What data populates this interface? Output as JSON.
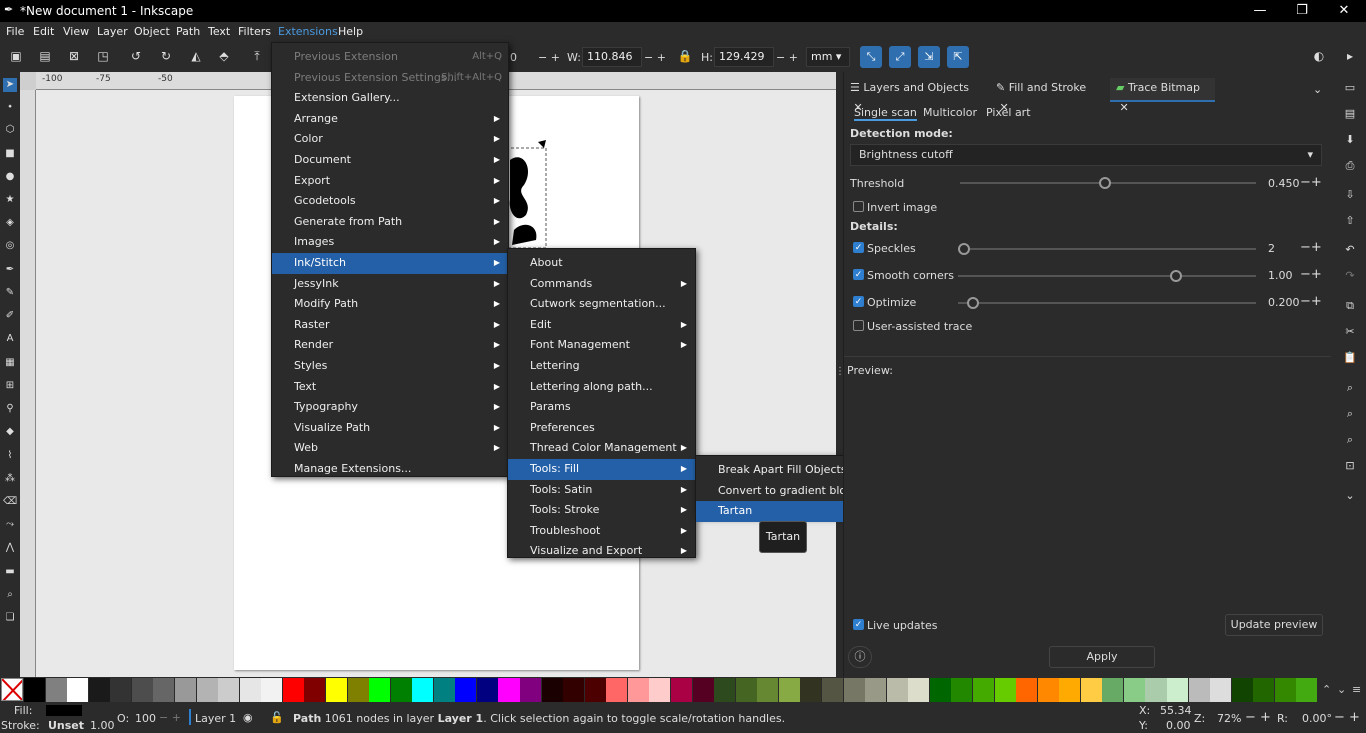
{
  "window": {
    "title": "*New document 1 - Inkscape"
  },
  "menubar": [
    "File",
    "Edit",
    "View",
    "Layer",
    "Object",
    "Path",
    "Text",
    "Filters",
    "Extensions",
    "Help"
  ],
  "toolbar": {
    "x_value_partial": "0",
    "w_label": "W:",
    "w_value": "110.846",
    "h_label": "H:",
    "h_value": "129.429",
    "unit": "mm"
  },
  "ruler": {
    "ticks": [
      "-100",
      "-75",
      "-50"
    ]
  },
  "extensions_menu": [
    {
      "label": "Previous Extension",
      "shortcut": "Alt+Q",
      "disabled": true
    },
    {
      "label": "Previous Extension Settings...",
      "shortcut": "Shift+Alt+Q",
      "disabled": true
    },
    {
      "label": "Extension Gallery..."
    },
    {
      "label": "Arrange",
      "sub": true
    },
    {
      "label": "Color",
      "sub": true
    },
    {
      "label": "Document",
      "sub": true
    },
    {
      "label": "Export",
      "sub": true
    },
    {
      "label": "Gcodetools",
      "sub": true
    },
    {
      "label": "Generate from Path",
      "sub": true
    },
    {
      "label": "Images",
      "sub": true
    },
    {
      "label": "Ink/Stitch",
      "sub": true,
      "hl": true
    },
    {
      "label": "JessyInk",
      "sub": true
    },
    {
      "label": "Modify Path",
      "sub": true
    },
    {
      "label": "Raster",
      "sub": true
    },
    {
      "label": "Render",
      "sub": true
    },
    {
      "label": "Styles",
      "sub": true
    },
    {
      "label": "Text",
      "sub": true
    },
    {
      "label": "Typography",
      "sub": true
    },
    {
      "label": "Visualize Path",
      "sub": true
    },
    {
      "label": "Web",
      "sub": true
    },
    {
      "label": "Manage Extensions..."
    }
  ],
  "inkstitch_menu": [
    {
      "label": "About"
    },
    {
      "label": "Commands",
      "sub": true
    },
    {
      "label": "Cutwork segmentation..."
    },
    {
      "label": "Edit",
      "sub": true
    },
    {
      "label": "Font Management",
      "sub": true
    },
    {
      "label": "Lettering"
    },
    {
      "label": "Lettering along path..."
    },
    {
      "label": "Params"
    },
    {
      "label": "Preferences"
    },
    {
      "label": "Thread Color Management",
      "sub": true
    },
    {
      "label": "Tools: Fill",
      "sub": true,
      "hl": true
    },
    {
      "label": "Tools: Satin",
      "sub": true
    },
    {
      "label": "Tools: Stroke",
      "sub": true
    },
    {
      "label": "Troubleshoot",
      "sub": true
    },
    {
      "label": "Visualize and Export",
      "sub": true
    }
  ],
  "fill_menu": [
    {
      "label": "Break Apart Fill Objects..."
    },
    {
      "label": "Convert to gradient blocks..."
    },
    {
      "label": "Tartan",
      "hl": true
    }
  ],
  "tooltip": "Tartan",
  "dock": {
    "tabs": [
      "Layers and Objects",
      "Fill and Stroke",
      "Trace Bitmap"
    ],
    "subtabs": [
      "Single scan",
      "Multicolor",
      "Pixel art"
    ],
    "detection_label": "Detection mode:",
    "detection_value": "Brightness cutoff",
    "threshold_label": "Threshold",
    "threshold_value": "0.450",
    "threshold_pos": 0.49,
    "invert_label": "Invert image",
    "details_label": "Details:",
    "speckles_label": "Speckles",
    "speckles_value": "2",
    "speckles_pos": 0.0,
    "smooth_label": "Smooth corners",
    "smooth_value": "1.00",
    "smooth_pos": 0.74,
    "optimize_label": "Optimize",
    "optimize_value": "0.200",
    "optimize_pos": 0.03,
    "user_assisted_label": "User-assisted trace",
    "preview_label": "Preview:",
    "live_updates_label": "Live updates",
    "update_preview_label": "Update preview",
    "apply_label": "Apply"
  },
  "status": {
    "fill_label": "Fill:",
    "stroke_label": "Stroke:",
    "stroke_value": "Unset",
    "stroke_width": "1.00",
    "opacity_label": "O:",
    "opacity_value": "100",
    "layer": "Layer 1",
    "message_bold": "Path",
    "message": " 1061 nodes in layer ",
    "message_layer": "Layer 1",
    "message_tail": ". Click selection again to toggle scale/rotation handles.",
    "x_label": "X:",
    "x_value": "55.34",
    "y_label": "Y:",
    "y_value": "0.00",
    "z_label": "Z:",
    "zoom": "72%",
    "r_label": "R:",
    "rotation": "0.00°"
  },
  "palette_colors": [
    "#000000",
    "#808080",
    "#ffffff",
    "#1a1a1a",
    "#333333",
    "#4d4d4d",
    "#666666",
    "#999999",
    "#b3b3b3",
    "#cccccc",
    "#e6e6e6",
    "#f2f2f2",
    "#ff0000",
    "#800000",
    "#ffff00",
    "#808000",
    "#00ff00",
    "#008000",
    "#00ffff",
    "#008080",
    "#0000ff",
    "#000080",
    "#ff00ff",
    "#800080",
    "#1a0000",
    "#330000",
    "#4d0000",
    "#ff6666",
    "#ff9999",
    "#ffcccc",
    "#aa0044",
    "#550022",
    "#2d4a1e",
    "#446622",
    "#668833",
    "#88aa44",
    "#333322",
    "#555544",
    "#777766",
    "#999988",
    "#bbbbaa",
    "#ddddcc",
    "#006600",
    "#228800",
    "#44aa00",
    "#66cc00",
    "#ff6600",
    "#ff8800",
    "#ffaa00",
    "#ffcc44",
    "#66aa66",
    "#88cc88",
    "#aaccaa",
    "#cceecc",
    "#bbbbbb",
    "#dddddd",
    "#114400",
    "#226600",
    "#338800",
    "#44aa11"
  ]
}
